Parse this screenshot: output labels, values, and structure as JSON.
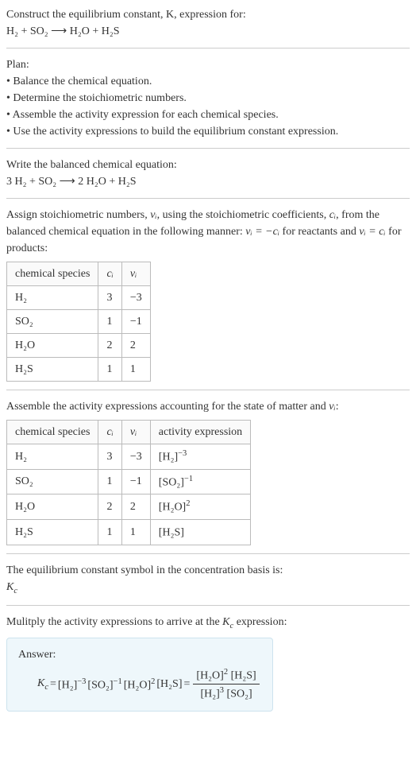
{
  "intro": {
    "line1": "Construct the equilibrium constant, K, expression for:",
    "eq": "H₂ + SO₂ ⟶ H₂O + H₂S"
  },
  "plan": {
    "heading": "Plan:",
    "b1": "• Balance the chemical equation.",
    "b2": "• Determine the stoichiometric numbers.",
    "b3": "• Assemble the activity expression for each chemical species.",
    "b4": "• Use the activity expressions to build the equilibrium constant expression."
  },
  "balanced": {
    "heading": "Write the balanced chemical equation:",
    "eq": "3 H₂ + SO₂ ⟶ 2 H₂O + H₂S"
  },
  "stoich": {
    "text_a": "Assign stoichiometric numbers, ",
    "nu_i": "νᵢ",
    "text_b": ", using the stoichiometric coefficients, ",
    "c_i": "cᵢ",
    "text_c": ", from the balanced chemical equation in the following manner: ",
    "rel1": "νᵢ = −cᵢ",
    "text_d": " for reactants and ",
    "rel2": "νᵢ = cᵢ",
    "text_e": " for products:",
    "headers": {
      "a": "chemical species",
      "b": "cᵢ",
      "c": "νᵢ"
    },
    "rows": [
      {
        "sp": "H₂",
        "c": "3",
        "v": "−3"
      },
      {
        "sp": "SO₂",
        "c": "1",
        "v": "−1"
      },
      {
        "sp": "H₂O",
        "c": "2",
        "v": "2"
      },
      {
        "sp": "H₂S",
        "c": "1",
        "v": "1"
      }
    ]
  },
  "activity": {
    "text_a": "Assemble the activity expressions accounting for the state of matter and ",
    "nu_i": "νᵢ",
    "text_b": ":",
    "headers": {
      "a": "chemical species",
      "b": "cᵢ",
      "c": "νᵢ",
      "d": "activity expression"
    },
    "rows": [
      {
        "sp": "H₂",
        "c": "3",
        "v": "−3",
        "ae_base": "[H₂]",
        "ae_exp": "−3"
      },
      {
        "sp": "SO₂",
        "c": "1",
        "v": "−1",
        "ae_base": "[SO₂]",
        "ae_exp": "−1"
      },
      {
        "sp": "H₂O",
        "c": "2",
        "v": "2",
        "ae_base": "[H₂O]",
        "ae_exp": "2"
      },
      {
        "sp": "H₂S",
        "c": "1",
        "v": "1",
        "ae_base": "[H₂S]",
        "ae_exp": ""
      }
    ]
  },
  "kc_symbol": {
    "line1": "The equilibrium constant symbol in the concentration basis is:",
    "sym": "K",
    "sub": "c"
  },
  "multiply": {
    "text_a": "Mulitply the activity expressions to arrive at the ",
    "kc": "K",
    "kc_sub": "c",
    "text_b": " expression:"
  },
  "answer": {
    "label": "Answer:",
    "kc": "K",
    "kc_sub": "c",
    "eq_sign": " = ",
    "t1_base": "[H₂]",
    "t1_exp": "−3",
    "t2_base": "[SO₂]",
    "t2_exp": "−1",
    "t3_base": "[H₂O]",
    "t3_exp": "2",
    "t4_base": "[H₂S]",
    "frac_num_a_base": "[H₂O]",
    "frac_num_a_exp": "2",
    "frac_num_b": "[H₂S]",
    "frac_den_a_base": "[H₂]",
    "frac_den_a_exp": "3",
    "frac_den_b": "[SO₂]"
  }
}
